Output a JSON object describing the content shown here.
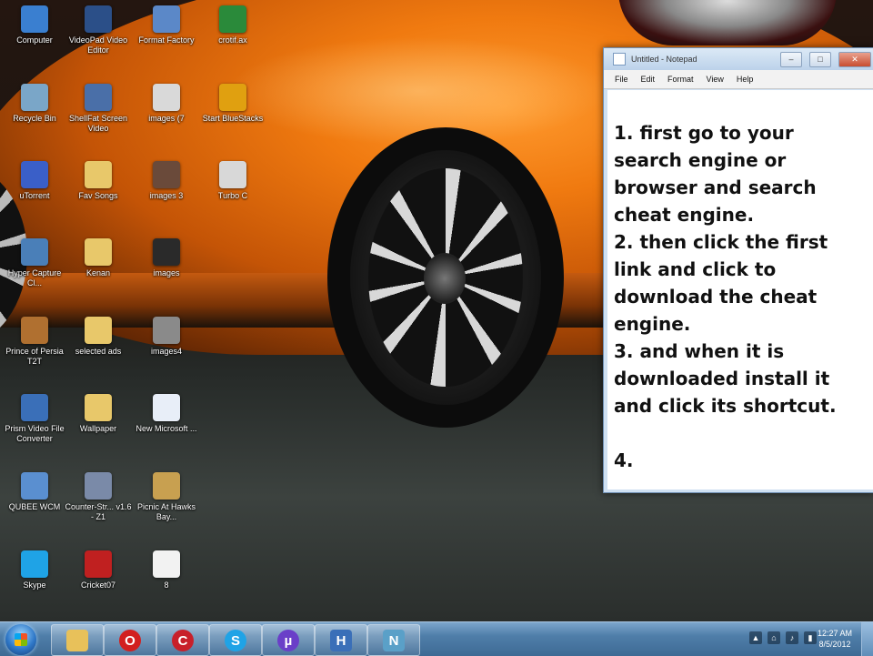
{
  "desktop": {
    "icons": [
      {
        "label": "Computer",
        "icon": "computer-icon",
        "color": "#3a7fd0"
      },
      {
        "label": "VideoPad Video Editor",
        "icon": "video-editor-icon",
        "color": "#2b4f88"
      },
      {
        "label": "Format Factory",
        "icon": "format-factory-icon",
        "color": "#5b88c8"
      },
      {
        "label": "crotif.ax",
        "icon": "shortcut-icon",
        "color": "#2a8a3a"
      },
      {
        "label": "Recycle Bin",
        "icon": "recycle-bin-icon",
        "color": "#7aa6c8"
      },
      {
        "label": "ShellFat Screen Video",
        "icon": "screen-video-icon",
        "color": "#4a6fa8"
      },
      {
        "label": "images (7",
        "icon": "image-file-icon",
        "color": "#d9d9d9"
      },
      {
        "label": "Start BlueStacks",
        "icon": "bluestacks-icon",
        "color": "#e0a010"
      },
      {
        "label": "uTorrent",
        "icon": "utorrent-icon",
        "color": "#3a5fc8"
      },
      {
        "label": "Fav Songs",
        "icon": "folder-icon",
        "color": "#e8c86a"
      },
      {
        "label": "images 3",
        "icon": "image-file-icon",
        "color": "#6a4a3a"
      },
      {
        "label": "Turbo C",
        "icon": "turbo-c-icon",
        "color": "#d8d8d8"
      },
      {
        "label": "Hyper Capture Cl...",
        "icon": "floppy-disk-icon",
        "color": "#4a7fb8"
      },
      {
        "label": "Kenan",
        "icon": "folder-icon",
        "color": "#e8c86a"
      },
      {
        "label": "images",
        "icon": "image-file-icon",
        "color": "#2a2a2a"
      },
      {
        "label": "Prince of Persia T2T",
        "icon": "game-icon",
        "color": "#b07030"
      },
      {
        "label": "selected ads",
        "icon": "folder-icon",
        "color": "#e8c86a"
      },
      {
        "label": "images4",
        "icon": "image-file-icon",
        "color": "#8a8a8a"
      },
      {
        "label": "Prism Video File Converter",
        "icon": "video-converter-icon",
        "color": "#3a6fb8"
      },
      {
        "label": "Wallpaper",
        "icon": "folder-icon",
        "color": "#e8c86a"
      },
      {
        "label": "New Microsoft ...",
        "icon": "document-icon",
        "color": "#e8eef8"
      },
      {
        "label": "QUBEE WCM",
        "icon": "qubee-icon",
        "color": "#5a8fd0"
      },
      {
        "label": "Counter-Str... v1.6 - Z1",
        "icon": "counter-strike-icon",
        "color": "#7a8aa8"
      },
      {
        "label": "Picnic At Hawks Bay...",
        "icon": "media-file-icon",
        "color": "#c8a050"
      },
      {
        "label": "Skype",
        "icon": "skype-icon",
        "color": "#1fa3e6"
      },
      {
        "label": "Cricket07",
        "icon": "cricket-icon",
        "color": "#c02020"
      },
      {
        "label": "8",
        "icon": "blank-file-icon",
        "color": "#f2f2f2"
      }
    ]
  },
  "notepad": {
    "title": "Untitled - Notepad",
    "menu": [
      "File",
      "Edit",
      "Format",
      "View",
      "Help"
    ],
    "controls": {
      "minimize": "–",
      "maximize": "□",
      "close": "✕"
    },
    "lines": [
      "1. first go to your",
      "search engine or",
      "browser and search",
      "cheat engine.",
      "2. then click the first",
      "link and click to",
      "download the cheat",
      "engine.",
      "3. and when it is",
      "downloaded install it",
      "and click its shortcut.",
      "",
      "4."
    ]
  },
  "taskbar": {
    "pinned": [
      {
        "name": "explorer",
        "icon": "folder-icon",
        "color": "#e8c15a",
        "glyph": ""
      },
      {
        "name": "opera",
        "icon": "opera-icon",
        "color": "#d21f1f",
        "glyph": "O"
      },
      {
        "name": "cricket",
        "icon": "cricket-icon",
        "color": "#c8202a",
        "glyph": "C"
      },
      {
        "name": "skype",
        "icon": "skype-icon",
        "color": "#1fa3e6",
        "glyph": "S"
      },
      {
        "name": "utorrent",
        "icon": "utorrent-icon",
        "color": "#6a3fc8",
        "glyph": "µ"
      },
      {
        "name": "save",
        "icon": "floppy-disk-icon",
        "color": "#3a6fb8",
        "glyph": "H"
      },
      {
        "name": "notepad",
        "icon": "notepad-icon",
        "color": "#5aa0c8",
        "glyph": "N"
      }
    ],
    "tray": [
      "▲",
      "⌂",
      "♪",
      "▮"
    ],
    "clock": {
      "time": "12:27 AM",
      "date": "8/5/2012"
    }
  }
}
